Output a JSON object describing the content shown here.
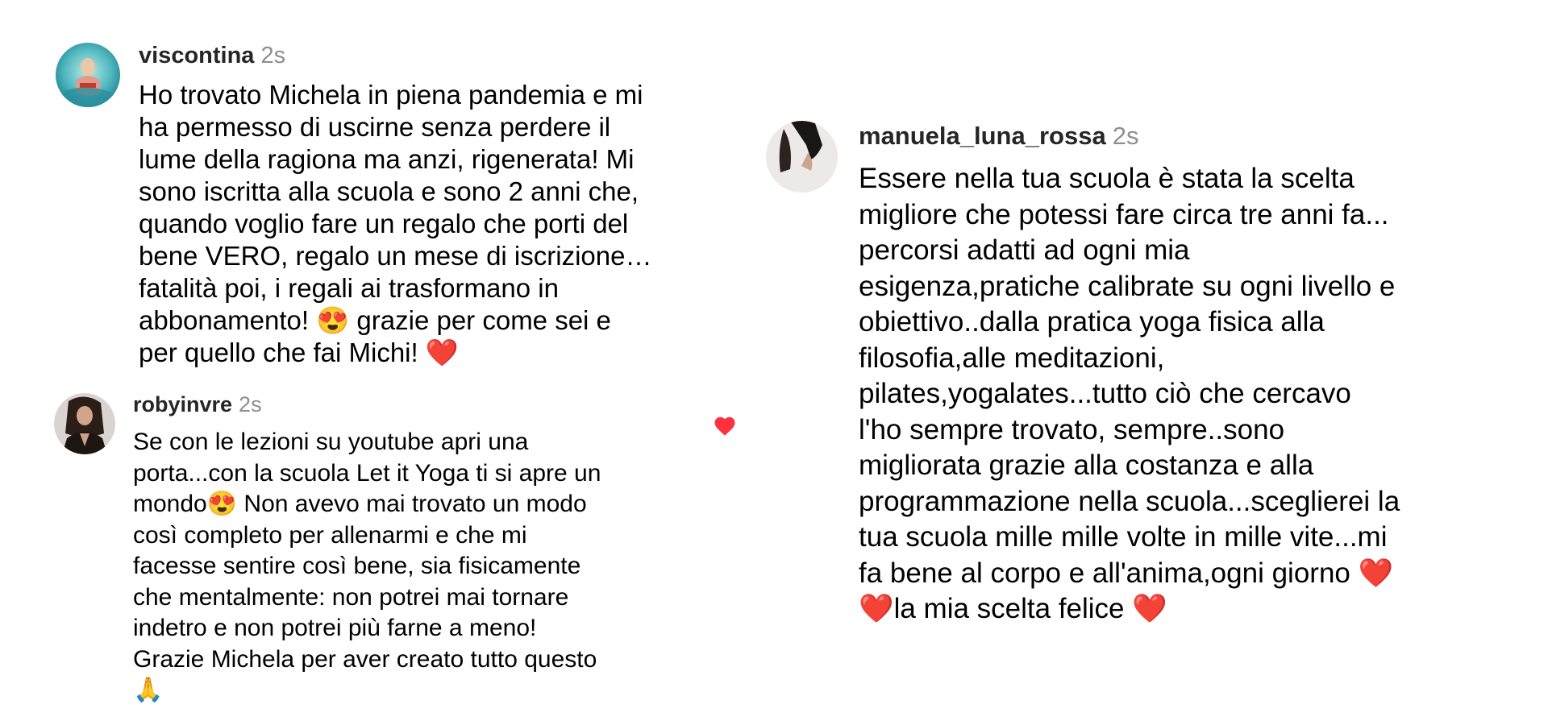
{
  "comments": [
    {
      "username": "viscontina",
      "time": "2s",
      "liked": false,
      "lines": [
        "Ho trovato Michela in piena pandemia e mi",
        "ha permesso di uscirne senza perdere il",
        "lume della ragiona ma anzi, rigenerata! Mi",
        "sono iscritta alla scuola e sono 2 anni che,",
        "quando voglio fare un regalo che porti del",
        "bene VERO, regalo un mese di iscrizione…",
        "fatalità poi, i regali ai trasformano in",
        "abbonamento! 😍 grazie per come sei e",
        "per quello che fai Michi! ❤️"
      ]
    },
    {
      "username": "robyinvre",
      "time": "2s",
      "liked": true,
      "lines": [
        "Se con le lezioni su youtube apri una",
        "porta...con la scuola Let it Yoga ti si apre un",
        "mondo😍 Non avevo mai trovato un modo",
        "così completo per allenarmi e che mi",
        "facesse sentire così bene, sia fisicamente",
        "che mentalmente: non potrei mai tornare",
        "indetro e non potrei più farne a meno!",
        "Grazie Michela per aver creato tutto questo",
        "🙏"
      ]
    },
    {
      "username": "manuela_luna_rossa",
      "time": "2s",
      "liked": false,
      "lines": [
        "Essere nella tua scuola è stata la scelta",
        "migliore che potessi fare circa tre anni fa...",
        "percorsi adatti ad ogni mia",
        "esigenza,pratiche calibrate su ogni livello e",
        "obiettivo..dalla pratica yoga fisica alla",
        "filosofia,alle meditazioni,",
        "pilates,yogalates...tutto ciò che cercavo",
        "l'ho sempre trovato, sempre..sono",
        "migliorata grazie alla costanza e alla",
        "programmazione nella scuola...sceglierei la",
        "tua scuola mille mille volte in mille vite...mi",
        "fa bene al corpo e all'anima,ogni giorno ❤️",
        "❤️la mia scelta felice ❤️"
      ]
    }
  ],
  "colors": {
    "username": "#262626",
    "timestamp": "#8e8e8e",
    "text": "#000000",
    "like_heart": "#ff3040"
  },
  "icons": {
    "like": "heart-filled-icon"
  }
}
